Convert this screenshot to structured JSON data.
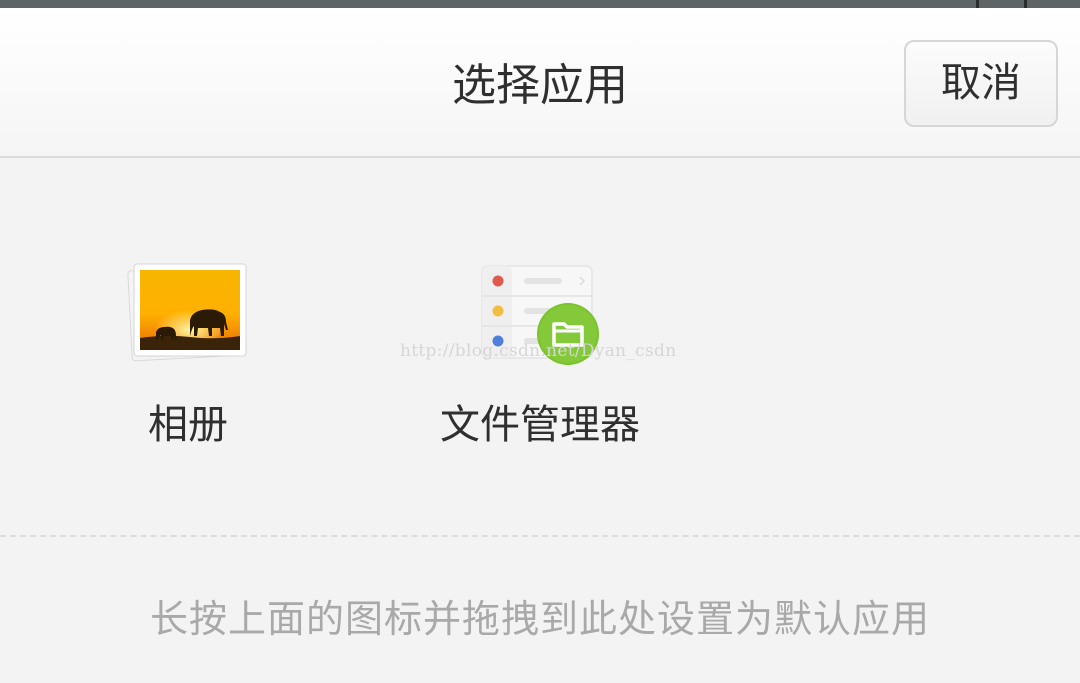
{
  "dialog": {
    "title": "选择应用",
    "cancel_label": "取消"
  },
  "apps": [
    {
      "label": "相册",
      "icon": "gallery-icon"
    },
    {
      "label": "文件管理器",
      "icon": "file-manager-icon"
    }
  ],
  "watermark": "http://blog.csdn.net/Dyan_csdn",
  "hint": "长按上面的图标并拖拽到此处设置为默认应用",
  "colors": {
    "background": "#f3f3f3",
    "text": "#2f2f2f",
    "hint_text": "#a9a9a9",
    "folder_badge": "#7cc22c"
  }
}
